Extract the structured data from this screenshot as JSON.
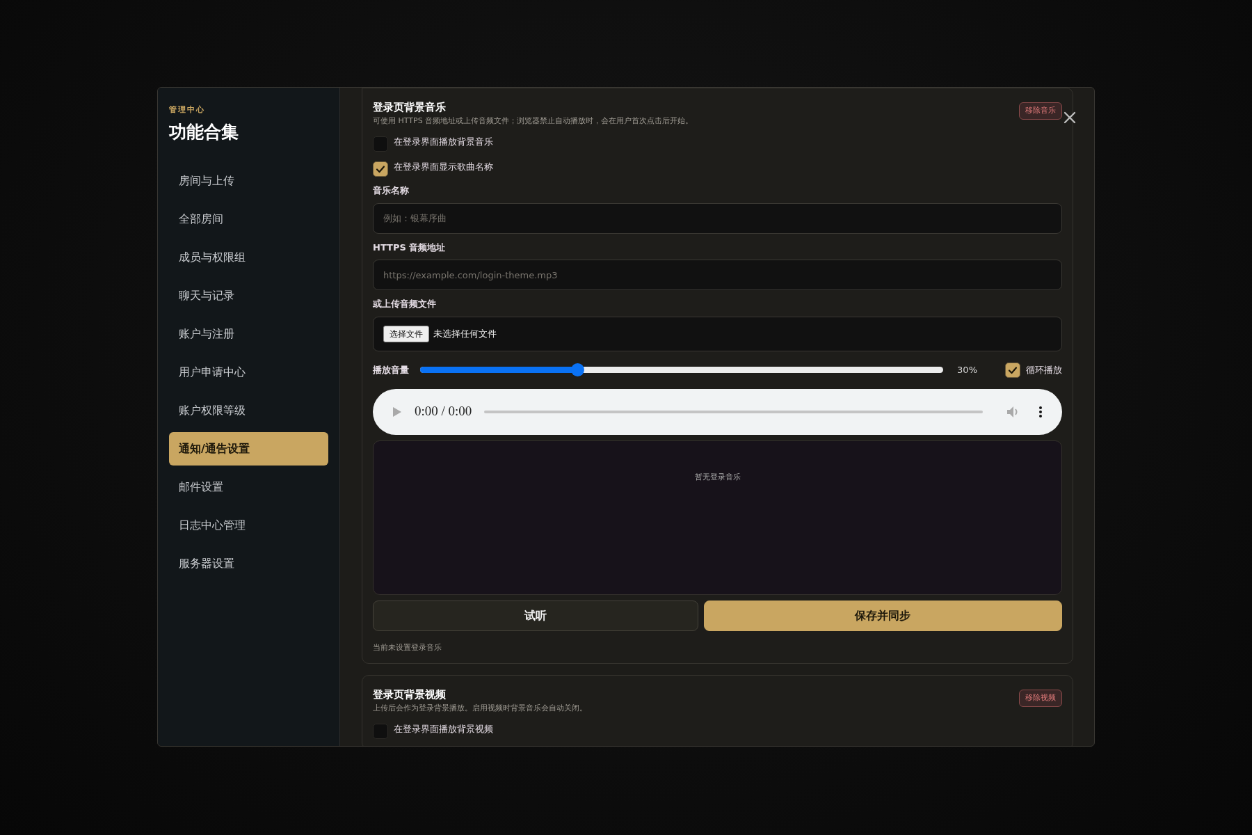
{
  "sidebar": {
    "eyebrow": "管理中心",
    "title": "功能合集",
    "items": [
      {
        "label": "房间与上传",
        "selected": false
      },
      {
        "label": "全部房间",
        "selected": false
      },
      {
        "label": "成员与权限组",
        "selected": false
      },
      {
        "label": "聊天与记录",
        "selected": false
      },
      {
        "label": "账户与注册",
        "selected": false
      },
      {
        "label": "用户申请中心",
        "selected": false
      },
      {
        "label": "账户权限等级",
        "selected": false
      },
      {
        "label": "通知/通告设置",
        "selected": true
      },
      {
        "label": "邮件设置",
        "selected": false
      },
      {
        "label": "日志中心管理",
        "selected": false
      },
      {
        "label": "服务器设置",
        "selected": false
      }
    ]
  },
  "music": {
    "title": "登录页背景音乐",
    "description": "可使用 HTTPS 音频地址或上传音频文件；浏览器禁止自动播放时，会在用户首次点击后开始。",
    "remove_button": "移除音乐",
    "checkboxes": [
      {
        "label": "在登录界面播放背景音乐",
        "checked": false
      },
      {
        "label": "在登录界面显示歌曲名称",
        "checked": true
      }
    ],
    "name_field": {
      "label": "音乐名称",
      "placeholder": "例如：银幕序曲"
    },
    "url_field": {
      "label": "HTTPS 音频地址",
      "placeholder": "https://example.com/login-theme.mp3"
    },
    "upload": {
      "label": "或上传音频文件",
      "button": "选择文件",
      "status": "未选择任何文件"
    },
    "volume": {
      "label": "播放音量",
      "level": 0.3,
      "reading": "30%"
    },
    "loop": {
      "label": "循环播放",
      "checked": true
    },
    "player": {
      "time": "0:00 / 0:00"
    },
    "preview": {
      "empty_text": "暂无登录音乐"
    },
    "buttons": [
      {
        "label": "试听",
        "kind": "secondary"
      },
      {
        "label": "保存并同步",
        "kind": "primary"
      }
    ],
    "note": "当前未设置登录音乐"
  },
  "video": {
    "title": "登录页背景视频",
    "description": "上传后会作为登录背景播放。启用视频时背景音乐会自动关闭。",
    "remove_button": "移除视频",
    "checkboxes": [
      {
        "label": "在登录界面播放背景视频",
        "checked": false
      }
    ]
  }
}
